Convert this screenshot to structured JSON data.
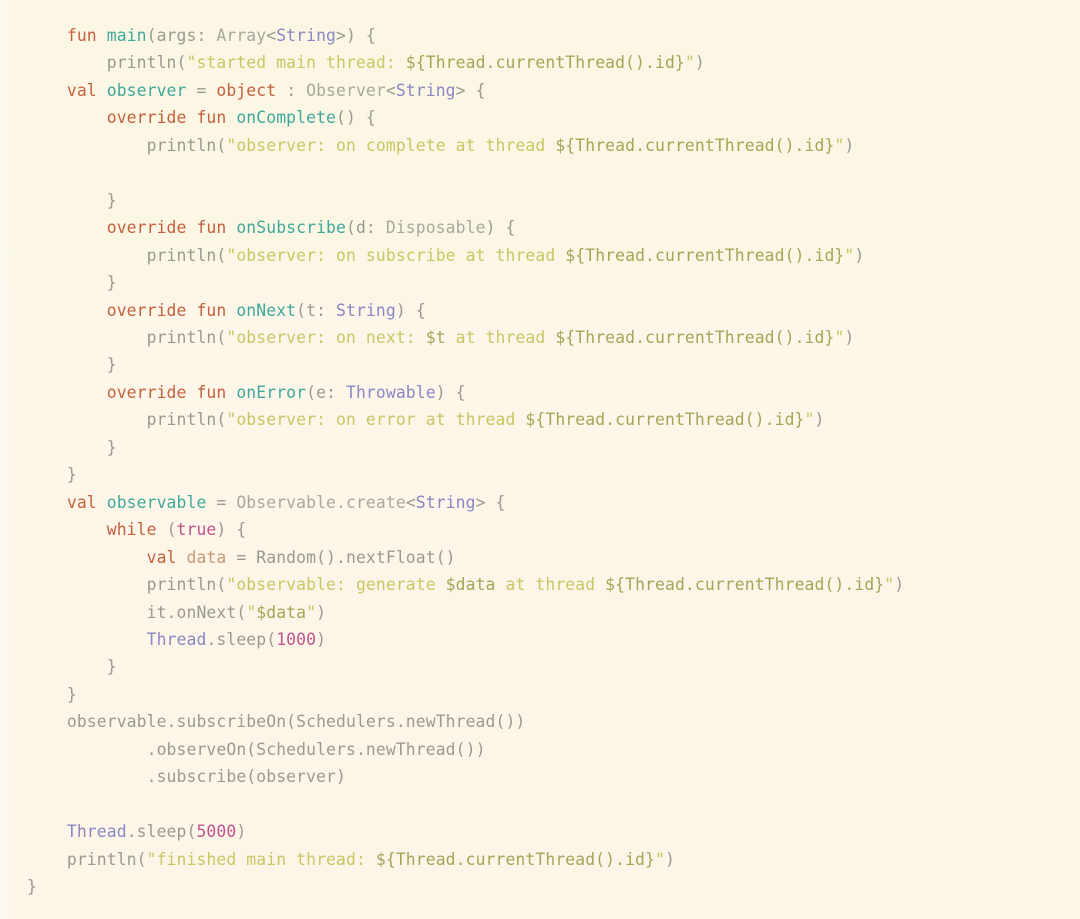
{
  "editor": {
    "language": "Kotlin",
    "background_color": "#fbf6e3",
    "default_text_color": "#9a9a92",
    "font_size_px": 16,
    "tab_size": 4
  },
  "palette": {
    "keyword": "#c4603d",
    "function_name": "#3fa89b",
    "identifier": "#9a9a92",
    "resolved_type": "#8a87c4",
    "unresolved_type": "#a8a89e",
    "string": "#c8c763",
    "template_expression": "#a3a657",
    "number": "#c0558e",
    "local_value": "#c49a78"
  },
  "code": {
    "line_01": {
      "kw_fun": "fun",
      "name": "main",
      "open_paren": "(",
      "arg": "args: ",
      "array": "Array",
      "lt": "<",
      "string_type": "String",
      "gt_paren": ">)",
      "brace": " {"
    },
    "line_02": {
      "call": "println(",
      "quote": "\"",
      "text": "started main thread: ",
      "tmpl": "${Thread.currentThread().id}",
      "quote_close": "\"",
      "close": ")"
    },
    "line_03": {
      "kw_val": "val",
      "name": "observer",
      "eq": "=",
      "kw_object": "object",
      "colon": ":",
      "type": "Observer",
      "lt": "<",
      "generic": "String",
      "gt": ">",
      "brace": "{"
    },
    "line_04": {
      "kw_override": "override",
      "kw_fun": "fun",
      "name": "onComplete",
      "sig": "() {"
    },
    "line_05": {
      "call": "println(",
      "quote": "\"",
      "text": "observer: on complete at thread ",
      "tmpl": "${Thread.currentThread().id}",
      "quote_close": "\"",
      "close": ")"
    },
    "line_06": {
      "blank": ""
    },
    "line_07": {
      "brace": "}"
    },
    "line_08": {
      "kw_override": "override",
      "kw_fun": "fun",
      "name": "onSubscribe",
      "sig": "(d: Disposable) {",
      "param": "(d: ",
      "ptype": "Disposable",
      "tail": ") {"
    },
    "line_09": {
      "call": "println(",
      "quote": "\"",
      "text": "observer: on subscribe at thread ",
      "tmpl": "${Thread.currentThread().id}",
      "quote_close": "\"",
      "close": ")"
    },
    "line_10": {
      "brace": "}"
    },
    "line_11": {
      "kw_override": "override",
      "kw_fun": "fun",
      "name": "onNext",
      "param": "(t: ",
      "ptype": "String",
      "tail": ") {"
    },
    "line_12": {
      "call": "println(",
      "quote": "\"",
      "text_a": "observer: on next: ",
      "tmpl_a": "$t",
      "text_b": " at thread ",
      "tmpl_b": "${Thread.currentThread().id}",
      "quote_close": "\"",
      "close": ")"
    },
    "line_13": {
      "brace": "}"
    },
    "line_14": {
      "kw_override": "override",
      "kw_fun": "fun",
      "name": "onError",
      "param": "(e: ",
      "ptype": "Throwable",
      "tail": ") {"
    },
    "line_15": {
      "call": "println(",
      "quote": "\"",
      "text": "observer: on error at thread ",
      "tmpl": "${Thread.currentThread().id}",
      "quote_close": "\"",
      "close": ")"
    },
    "line_16": {
      "brace": "}"
    },
    "line_17": {
      "brace": "}"
    },
    "line_18": {
      "kw_val": "val",
      "name": "observable",
      "eq": "=",
      "recv": "Observable.create",
      "lt": "<",
      "generic": "String",
      "gt": ">",
      "brace": "{"
    },
    "line_19": {
      "kw_while": "while",
      "paren_open": "(",
      "bool": "true",
      "tail": ") {"
    },
    "line_20": {
      "kw_val": "val",
      "name": "data",
      "eq": "=",
      "expr": "Random().nextFloat()"
    },
    "line_21": {
      "call": "println(",
      "quote": "\"",
      "text_a": "observable: generate ",
      "tmpl_a": "$data",
      "text_b": " at thread ",
      "tmpl_b": "${Thread.currentThread().id}",
      "quote_close": "\"",
      "close": ")"
    },
    "line_22": {
      "recv": "it.onNext(",
      "quote": "\"",
      "tmpl": "$data",
      "quote_close": "\"",
      "close": ")"
    },
    "line_23": {
      "type": "Thread",
      "member": ".sleep(",
      "num": "1000",
      "close": ")"
    },
    "line_24": {
      "brace": "}"
    },
    "line_25": {
      "brace": "}"
    },
    "line_26": {
      "text": "observable.subscribeOn(Schedulers.newThread())"
    },
    "line_27": {
      "text": ".observeOn(Schedulers.newThread())"
    },
    "line_28": {
      "text": ".subscribe(observer)"
    },
    "line_29": {
      "blank": ""
    },
    "line_30": {
      "type": "Thread",
      "member": ".sleep(",
      "num": "5000",
      "close": ")"
    },
    "line_31": {
      "call": "println(",
      "quote": "\"",
      "text": "finished main thread: ",
      "tmpl": "${Thread.currentThread().id}",
      "quote_close": "\"",
      "close": ")"
    },
    "line_32": {
      "brace": "}"
    }
  }
}
